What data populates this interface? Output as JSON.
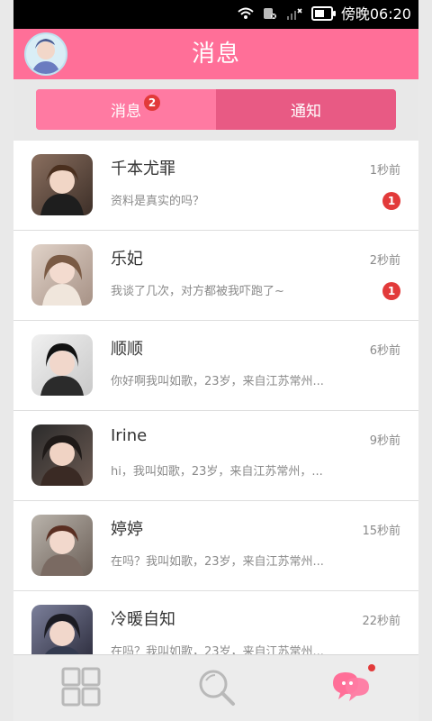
{
  "status_bar": {
    "time": "傍晚06:20",
    "icons": [
      "wifi-icon",
      "sim-icon",
      "signal-icon",
      "battery-icon"
    ]
  },
  "header": {
    "title": "消息",
    "avatar_icon": "user-avatar-icon"
  },
  "tabs": [
    {
      "label": "消息",
      "badge": "2",
      "selected": true
    },
    {
      "label": "通知",
      "selected": false
    }
  ],
  "conversations": [
    {
      "name": "千本尤罪",
      "time": "1秒前",
      "preview": "资料是真实的吗？",
      "unread": "1",
      "avatar_color": "#5a4a3f"
    },
    {
      "name": "乐妃",
      "time": "2秒前",
      "preview": "我谈了几次，对方都被我吓跑了~",
      "unread": "1",
      "avatar_color": "#b7a49a"
    },
    {
      "name": "顺顺",
      "time": "6秒前",
      "preview": "你好啊我叫如歌，23岁，来自江苏常州...",
      "unread": "",
      "avatar_color": "#2c2a2a"
    },
    {
      "name": "Irine",
      "time": "9秒前",
      "preview": "hi，我叫如歌，23岁，来自江苏常州，...",
      "unread": "",
      "avatar_color": "#2f2523"
    },
    {
      "name": "婷婷",
      "time": "15秒前",
      "preview": "在吗？我叫如歌，23岁，来自江苏常州...",
      "unread": "",
      "avatar_color": "#4a3a32"
    },
    {
      "name": "冷暖自知",
      "time": "22秒前",
      "preview": "在吗？我叫如歌，23岁，来自江苏常州...",
      "unread": "",
      "avatar_color": "#2a2a3a"
    }
  ],
  "bottom_nav": [
    {
      "name": "grid-icon"
    },
    {
      "name": "search-icon"
    },
    {
      "name": "chat-icon",
      "has_dot": true
    }
  ],
  "colors": {
    "brand_pink": "#ff6f98",
    "badge_red": "#e23a3a",
    "text_gray": "#8a8a8a"
  }
}
